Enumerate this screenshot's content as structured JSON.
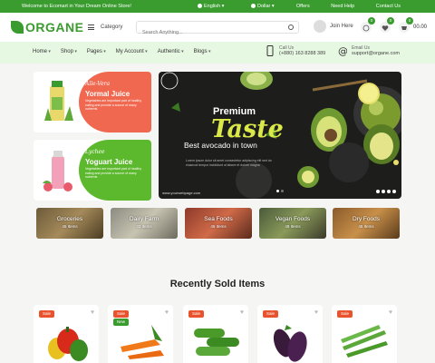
{
  "topbar": {
    "welcome": "Welcome to Ecomart in Your Dream Online Store!",
    "language": "English",
    "currency": "Dollar",
    "links": [
      "Offers",
      "Need Help",
      "Contact Us"
    ]
  },
  "header": {
    "logo": "ORGANE",
    "category_label": "Category",
    "search_placeholder": "Search Anything...",
    "account_label": "Join Here",
    "compare_count": "0",
    "wishlist_count": "0",
    "cart_count": "0",
    "cart_total": "00.00"
  },
  "nav": {
    "items": [
      "Home",
      "Shop",
      "Pages",
      "My Account",
      "Authentic",
      "Blogs"
    ],
    "call_label": "Call Us",
    "phone": "(+880) 163 8288 389",
    "email_label": "Email Us",
    "email": "support@organe.com"
  },
  "promos": [
    {
      "small": "Alle-Vera",
      "title": "Yormal Juice",
      "text": "Vegetables are important part of healthy eating and provide a source of many nutrients",
      "button": "Shop Now",
      "color": "#f0684f"
    },
    {
      "small": "Lychee",
      "title": "Yoguart Juice",
      "text": "Vegetables are important part of healthy eating and provide a source of many nutrients",
      "button": "Shop Now",
      "color": "#5cb82c"
    }
  ],
  "banner": {
    "premium": "Premium",
    "taste": "Taste",
    "best": "Best avocado in town",
    "desc": "Lorem ipsum dolor sit amet consectetur adipiscing elit sed do eiusmod tempor incididunt ut labore et dolore magna",
    "url": "www.yourwebpage.com"
  },
  "categories": [
    {
      "name": "Groceries",
      "count": "45 Items"
    },
    {
      "name": "Dairy Farm",
      "count": "33 Items"
    },
    {
      "name": "Sea Foods",
      "count": "45 Items"
    },
    {
      "name": "Vegan Foods",
      "count": "48 Items"
    },
    {
      "name": "Dry Foods",
      "count": "45 Items"
    }
  ],
  "section_title": "Recently Sold Items",
  "products": [
    {
      "tag": "Sale",
      "tag2": "",
      "name": "bell-peppers"
    },
    {
      "tag": "Sale",
      "tag2": "New",
      "name": "carrots"
    },
    {
      "tag": "Sale",
      "tag2": "",
      "name": "cucumbers"
    },
    {
      "tag": "Sale",
      "tag2": "",
      "name": "eggplants"
    },
    {
      "tag": "Sale",
      "tag2": "",
      "name": "okra"
    }
  ],
  "colors": {
    "brand": "#3a9b2f",
    "accent": "#e8522c",
    "nav_bg": "#e6f7e2"
  }
}
